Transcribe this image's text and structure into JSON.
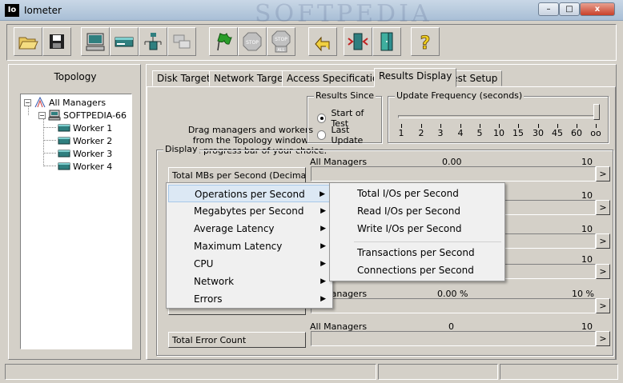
{
  "window": {
    "title": "Iometer",
    "icon_text": "Io",
    "watermark": "SOFTPEDIA",
    "minimize": "–",
    "maximize": "□",
    "close": "x"
  },
  "toolbar": {
    "buttons": [
      {
        "name": "open-config",
        "icon": "folder-open-icon"
      },
      {
        "name": "save-config",
        "icon": "floppy-disk-icon"
      },
      {
        "name": "start-display-manager",
        "icon": "computer-monitor-icon"
      },
      {
        "name": "new-disk-worker",
        "icon": "disk-worker-icon"
      },
      {
        "name": "new-network-worker",
        "icon": "network-worker-icon"
      },
      {
        "name": "duplicate-worker",
        "icon": "duplicate-worker-icon"
      },
      {
        "name": "start-tests",
        "icon": "green-flag-icon"
      },
      {
        "name": "stop-test",
        "icon": "stop-sign-icon",
        "label": "STOP"
      },
      {
        "name": "stop-all",
        "icon": "stop-all-icon",
        "label": "STOP",
        "sublabel": "ALL"
      },
      {
        "name": "reset-workers",
        "icon": "reset-arrow-icon"
      },
      {
        "name": "disconnect-manager",
        "icon": "disconnect-icon"
      },
      {
        "name": "exit",
        "icon": "exit-door-icon"
      },
      {
        "name": "about",
        "icon": "question-mark-icon",
        "label": "?"
      }
    ]
  },
  "topology": {
    "heading": "Topology",
    "root": "All Managers",
    "manager": "SOFTPEDIA-66",
    "workers": [
      "Worker 1",
      "Worker 2",
      "Worker 3",
      "Worker 4"
    ]
  },
  "tabs": [
    "Disk Targets",
    "Network Targets",
    "Access Specifications",
    "Results Display",
    "Test Setup"
  ],
  "active_tab": "Results Display",
  "instructions": [
    "Drag managers and workers",
    "from the Topology window",
    "to the progress bar of your choice."
  ],
  "results_since": {
    "legend": "Results Since",
    "options": [
      {
        "label": "Start of Test",
        "selected": true
      },
      {
        "label": "Last Update",
        "selected": false
      }
    ]
  },
  "update_frequency": {
    "legend": "Update Frequency (seconds)",
    "ticks": [
      "1",
      "2",
      "3",
      "4",
      "5",
      "10",
      "15",
      "30",
      "45",
      "60",
      "oo"
    ],
    "selected": "oo"
  },
  "display": {
    "legend": "Display",
    "rows": [
      {
        "metric": "Total MBs per Second (Decimal)",
        "target": "All Managers",
        "value": "0.00",
        "max": "10"
      },
      {
        "metric": "",
        "target": "",
        "value": "",
        "max": "10"
      },
      {
        "metric": "",
        "target": "",
        "value": "",
        "max": "10"
      },
      {
        "metric": "",
        "target": "",
        "value": "",
        "max": "10"
      },
      {
        "metric": "",
        "target": "All Managers",
        "value": "0.00 %",
        "max": "10 %"
      },
      {
        "metric": "Total Error Count",
        "target": "All Managers",
        "value": "0",
        "max": "10"
      }
    ],
    "arrow": ">"
  },
  "context_menu": {
    "items": [
      "Operations per Second",
      "Megabytes per Second",
      "Average Latency",
      "Maximum Latency",
      "CPU",
      "Network",
      "Errors"
    ],
    "highlighted": "Operations per Second",
    "arrow": "▶"
  },
  "submenu": {
    "items": [
      "Total I/Os per Second",
      "Read I/Os per Second",
      "Write I/Os per Second",
      "Transactions per Second",
      "Connections per Second"
    ]
  },
  "colors": {
    "menu_highlight": "#dce8f4",
    "face": "#d4d0c8",
    "flag_green": "#2a9d2a",
    "stop_red": "#c02020",
    "worker_teal": "#2f7f7f"
  }
}
